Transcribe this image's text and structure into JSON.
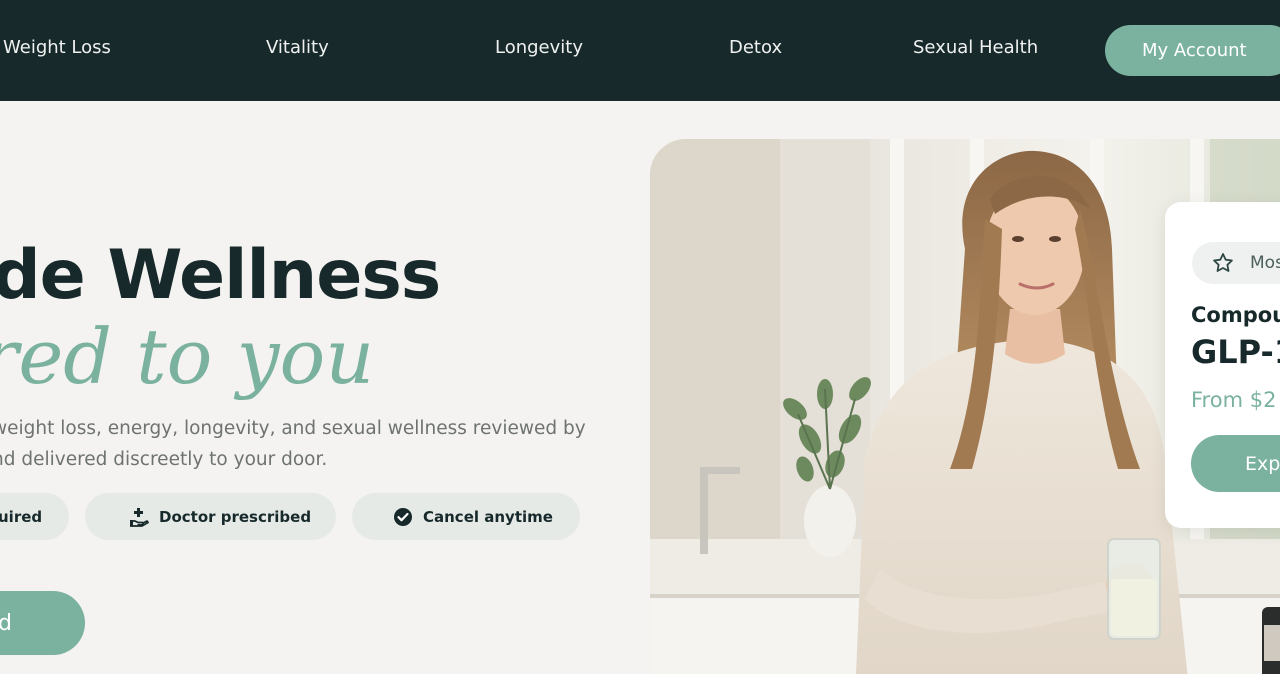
{
  "nav": {
    "links": [
      "Weight Loss",
      "Vitality",
      "Longevity",
      "Detox",
      "Sexual Health"
    ],
    "account_label": "My Account"
  },
  "hero": {
    "title": "de Wellness",
    "subtitle": "red to you",
    "description_lines": [
      "weight loss, energy, longevity, and sexual wellness reviewed by",
      "nd delivered discreetly to your door."
    ],
    "pills": [
      "uired",
      "Doctor prescribed",
      "Cancel anytime"
    ],
    "cta_label": "d"
  },
  "card": {
    "badge": "Mos",
    "kicker": "Compou",
    "name": "GLP-1",
    "price": "From $2",
    "button": "Expl"
  },
  "colors": {
    "nav_bg": "#17292a",
    "accent": "#7bb29f",
    "page_bg": "#f4f3f1",
    "pill_bg": "#e6eae7"
  },
  "icons": [
    "hand-medical-icon",
    "check-circle-icon",
    "star-icon"
  ]
}
